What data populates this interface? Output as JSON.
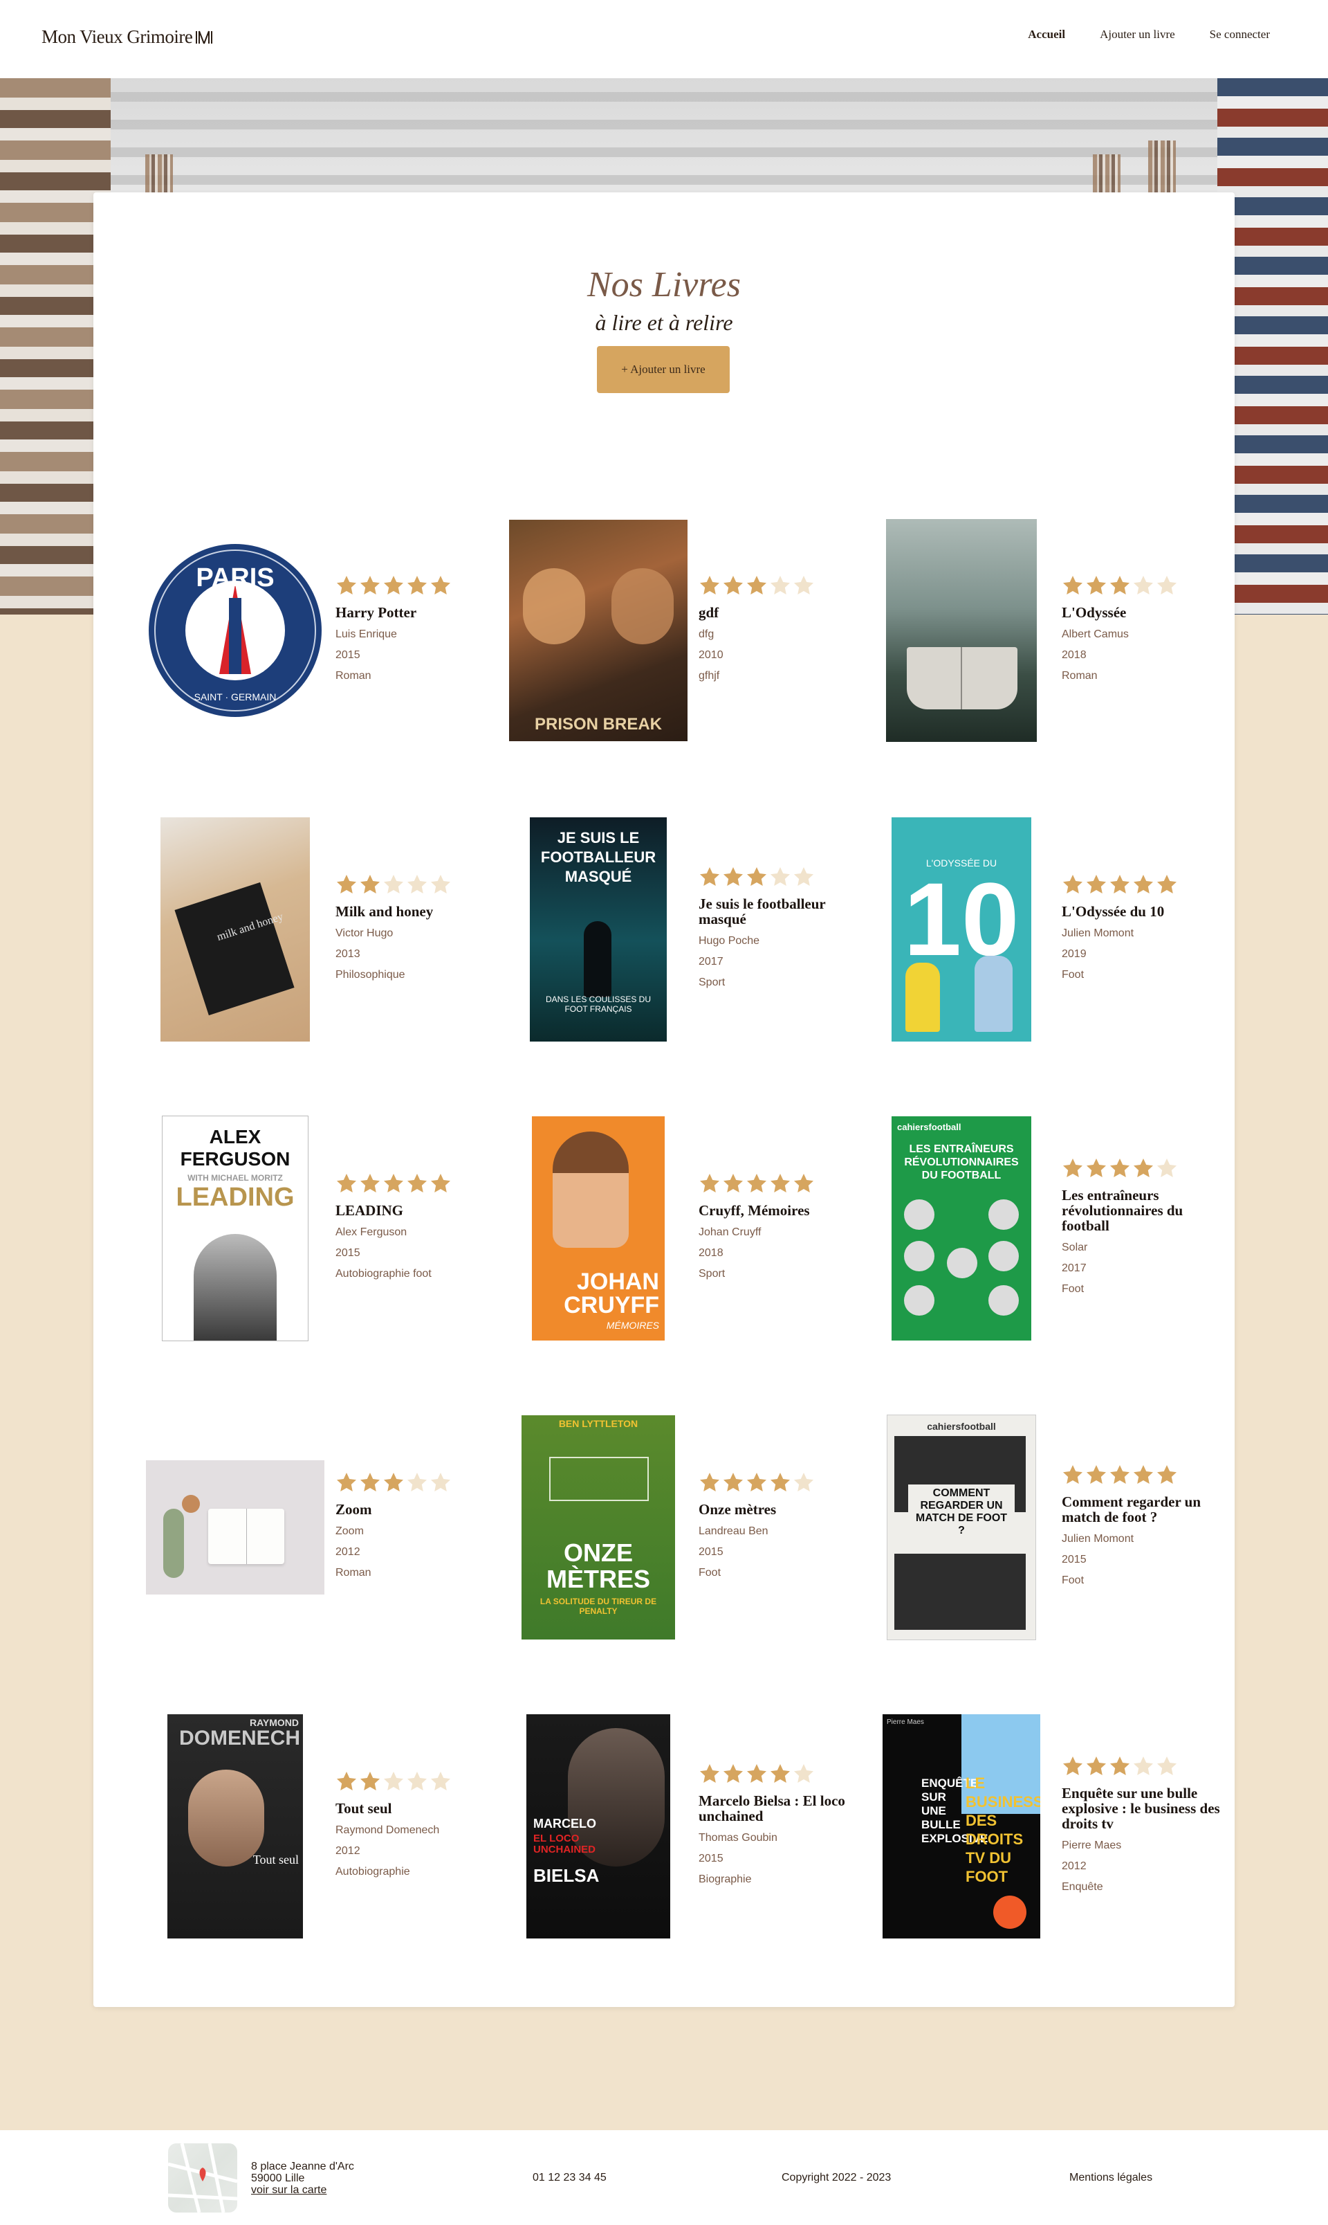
{
  "header": {
    "logo_text": "Mon Vieux Grimoire",
    "nav": [
      {
        "label": "Accueil",
        "active": true
      },
      {
        "label": "Ajouter un livre",
        "active": false
      },
      {
        "label": "Se connecter",
        "active": false
      }
    ]
  },
  "main": {
    "title": "Nos Livres",
    "subtitle": "à lire et à relire",
    "add_button": "+ Ajouter un livre"
  },
  "colors": {
    "accent": "#D6A55F",
    "background": "#F1E3CC",
    "star_empty": "#F1E3CC",
    "meta_text": "#7a5a48"
  },
  "books": [
    {
      "title": "Harry Potter",
      "author": "Luis Enrique",
      "year": "2015",
      "genre": "Roman",
      "rating": 5,
      "cover": "psg-crest"
    },
    {
      "title": "gdf",
      "author": "dfg",
      "year": "2010",
      "genre": "gfhjf",
      "rating": 3,
      "cover": "prison-break-poster"
    },
    {
      "title": "L'Odyssée",
      "author": "Albert Camus",
      "year": "2018",
      "genre": "Roman",
      "rating": 3,
      "cover": "open-book-forest"
    },
    {
      "title": "Milk and honey",
      "author": "Victor Hugo",
      "year": "2013",
      "genre": "Philosophique",
      "rating": 2,
      "cover": "milk-and-honey-book"
    },
    {
      "title": "Je suis le footballeur masqué",
      "author": "Hugo Poche",
      "year": "2017",
      "genre": "Sport",
      "rating": 3,
      "cover": "footballeur-masque-cover"
    },
    {
      "title": "L'Odyssée du 10",
      "author": "Julien Momont",
      "year": "2019",
      "genre": "Foot",
      "rating": 5,
      "cover": "odyssee-du-10-cover"
    },
    {
      "title": "LEADING",
      "author": "Alex Ferguson",
      "year": "2015",
      "genre": "Autobiographie foot",
      "rating": 5,
      "cover": "leading-cover"
    },
    {
      "title": "Cruyff, Mémoires",
      "author": "Johan Cruyff",
      "year": "2018",
      "genre": "Sport",
      "rating": 5,
      "cover": "cruyff-cover"
    },
    {
      "title": "Les entraîneurs révolutionnaires du football",
      "author": "Solar",
      "year": "2017",
      "genre": "Foot",
      "rating": 4,
      "cover": "entraineurs-cover"
    },
    {
      "title": "Zoom",
      "author": "Zoom",
      "year": "2012",
      "genre": "Roman",
      "rating": 3,
      "cover": "reading-flatlay"
    },
    {
      "title": "Onze mètres",
      "author": "Landreau Ben",
      "year": "2015",
      "genre": "Foot",
      "rating": 4,
      "cover": "onze-metres-cover"
    },
    {
      "title": "Comment regarder un match de foot ?",
      "author": "Julien Momont",
      "year": "2015",
      "genre": "Foot",
      "rating": 5,
      "cover": "regarder-match-cover"
    },
    {
      "title": "Tout seul",
      "author": "Raymond Domenech",
      "year": "2012",
      "genre": "Autobiographie",
      "rating": 2,
      "cover": "tout-seul-cover"
    },
    {
      "title": "Marcelo Bielsa : El loco unchained",
      "author": "Thomas Goubin",
      "year": "2015",
      "genre": "Biographie",
      "rating": 4,
      "cover": "bielsa-cover"
    },
    {
      "title": "Enquête sur une bulle explosive : le business des droits tv",
      "author": "Pierre Maes",
      "year": "2012",
      "genre": "Enquête",
      "rating": 3,
      "cover": "droits-tv-cover"
    }
  ],
  "cover_texts": {
    "psg_top": "PARIS",
    "psg_bottom": "SAINT · GERMAIN",
    "prison": "PRISON BREAK",
    "milk": "milk and honey",
    "masque_title": "JE SUIS LE FOOTBALLEUR MASQUÉ",
    "masque_sub": "DANS LES COULISSES DU FOOT FRANÇAIS",
    "odyssee10_top": "L'ODYSSÉE DU",
    "odyssee10_num": "10",
    "leading_name": "ALEX FERGUSON",
    "leading_with": "WITH MICHAEL MORITZ",
    "leading_title": "LEADING",
    "cruyff_name": "JOHAN CRUYFF",
    "cruyff_sub": "MÉMOIRES",
    "entraineurs_brand": "cahiersfootball",
    "entraineurs_title": "LES ENTRAÎNEURS RÉVOLUTIONNAIRES DU FOOTBALL",
    "onze_author": "BEN LYTTLETON",
    "onze_title": "ONZE MÈTRES",
    "onze_sub": "LA SOLITUDE DU TIREUR DE PENALTY",
    "regarder_brand": "cahiersfootball",
    "regarder_title": "COMMENT REGARDER UN MATCH DE FOOT ?",
    "domenech_first": "RAYMOND",
    "domenech_last": "DOMENECH",
    "domenech_title": "Tout seul",
    "bielsa_first": "MARCELO",
    "bielsa_mid": "EL LOCO UNCHAINED",
    "bielsa_last": "BIELSA",
    "droits_author": "Pierre Maes",
    "droits_left": "ENQUÊTE SUR UNE BULLE EXPLOSIVE",
    "droits_right": "LE BUSINESS DES DROITS TV DU FOOT"
  },
  "footer": {
    "address_line1": "8 place Jeanne d'Arc",
    "address_line2": "59000 Lille",
    "map_link": "voir sur la carte",
    "phone": "01 12 23 34 45",
    "copyright": "Copyright 2022 - 2023",
    "legal": "Mentions légales"
  }
}
